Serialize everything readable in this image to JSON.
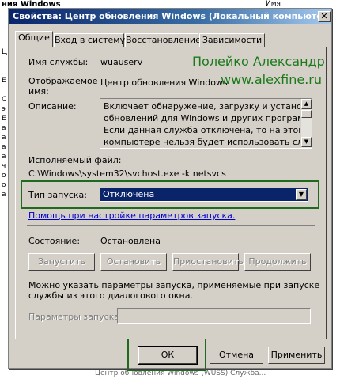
{
  "background": {
    "top_left_title": "ния Windows",
    "column_header": "Имя",
    "left_letters": [
      "Ц",
      "",
      "",
      "Е",
      "",
      "С",
      "э",
      "Е",
      "а",
      "а",
      "а",
      "а",
      "ч",
      "о",
      "о",
      "а"
    ],
    "bottom_text": "Центр обновления Windows (WUSS) Служба..."
  },
  "dialog": {
    "title": "Свойства: Центр обновления Windows (Локальный компьютер)",
    "close_glyph": "✕"
  },
  "tabs": [
    {
      "label": "Общие",
      "active": true
    },
    {
      "label": "Вход в систему",
      "active": false
    },
    {
      "label": "Восстановление",
      "active": false
    },
    {
      "label": "Зависимости",
      "active": false
    }
  ],
  "general": {
    "service_name_label": "Имя службы:",
    "service_name_value": "wuauserv",
    "display_name_label_1": "Отображаемое",
    "display_name_label_2": "имя:",
    "display_name_value": "Центр обновления Windows",
    "description_label": "Описание:",
    "description_lines": [
      "Включает обнаружение, загрузку и установку",
      "обновлений для Windows и других программ.",
      "Если данная служба отключена, то на этом",
      "компьютере нельзя будет использовать службу"
    ],
    "exe_label": "Исполняемый файл:",
    "exe_value": "C:\\Windows\\system32\\svchost.exe -k netsvcs",
    "startup_type_label": "Тип запуска:",
    "startup_type_value": "Отключена",
    "help_link": "Помощь при настройке параметров запуска.",
    "status_label": "Состояние:",
    "status_value": "Остановлена",
    "start_button": "Запустить",
    "stop_button": "Остановить",
    "pause_button": "Приостановить",
    "resume_button": "Продолжить",
    "hint_line_1": "Можно указать параметры запуска, применяемые при запуске",
    "hint_line_2": "службы из этого диалогового окна.",
    "start_params_label": "Параметры запуска:",
    "start_params_value": ""
  },
  "watermark": {
    "line_1": "Полейко Александр",
    "line_2": "www.alexfine.ru"
  },
  "footer": {
    "ok": "ОК",
    "cancel": "Отмена",
    "apply": "Применить"
  },
  "colors": {
    "title_bar": "#0a246a",
    "dialog_face": "#d4d0c8",
    "highlight_box": "#1e6b1e",
    "watermark": "#1a7a1a",
    "link": "#0000cc"
  }
}
